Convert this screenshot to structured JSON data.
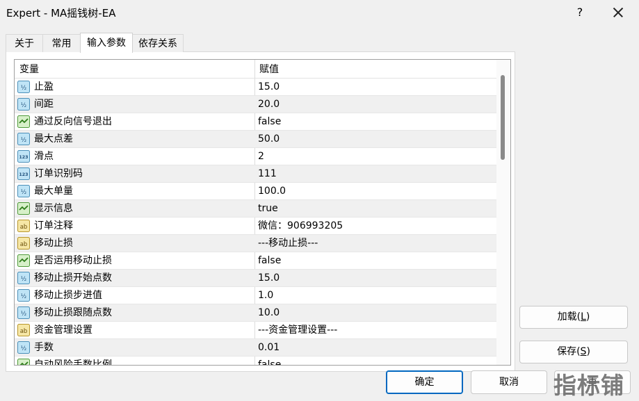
{
  "window": {
    "title": "Expert - MA摇钱树-EA",
    "help_label": "?"
  },
  "tabs": [
    {
      "label": "关于",
      "active": false
    },
    {
      "label": "常用",
      "active": false
    },
    {
      "label": "输入参数",
      "active": true
    },
    {
      "label": "依存关系",
      "active": false
    }
  ],
  "grid": {
    "col_variable": "变量",
    "col_value": "赋值",
    "rows": [
      {
        "icon": "double-value-icon",
        "name": "止盈",
        "value": "15.0"
      },
      {
        "icon": "double-value-icon",
        "name": "间距",
        "value": "20.0"
      },
      {
        "icon": "boolean-value-icon",
        "name": "通过反向信号退出",
        "value": "false"
      },
      {
        "icon": "double-value-icon",
        "name": "最大点差",
        "value": "50.0"
      },
      {
        "icon": "integer-value-icon",
        "name": "滑点",
        "value": "2"
      },
      {
        "icon": "integer-value-icon",
        "name": "订单识别码",
        "value": "111"
      },
      {
        "icon": "double-value-icon",
        "name": "最大单量",
        "value": "100.0"
      },
      {
        "icon": "boolean-value-icon",
        "name": "显示信息",
        "value": "true"
      },
      {
        "icon": "string-value-icon",
        "name": "订单注释",
        "value": "微信：906993205"
      },
      {
        "icon": "string-value-icon",
        "name": "移动止损",
        "value": "---移动止损---"
      },
      {
        "icon": "boolean-value-icon",
        "name": "是否运用移动止损",
        "value": "false"
      },
      {
        "icon": "double-value-icon",
        "name": "移动止损开始点数",
        "value": "15.0"
      },
      {
        "icon": "double-value-icon",
        "name": "移动止损步进值",
        "value": "1.0"
      },
      {
        "icon": "double-value-icon",
        "name": "移动止损跟随点数",
        "value": "10.0"
      },
      {
        "icon": "string-value-icon",
        "name": "资金管理设置",
        "value": "---资金管理设置---"
      },
      {
        "icon": "double-value-icon",
        "name": "手数",
        "value": "0.01"
      },
      {
        "icon": "boolean-value-icon",
        "name": "自动风险手数比例",
        "value": "false"
      }
    ]
  },
  "buttons": {
    "load_text": "加载",
    "load_hotkey": "L",
    "save_text": "保存",
    "save_hotkey": "S",
    "ok_label": "确定",
    "cancel_label": "取消",
    "reset_partial": "重"
  },
  "watermark": "指标铺",
  "colors": {
    "accent": "#0067c0",
    "grid_alt_row": "#f0f0f0",
    "icon_blue": "#9fd3ee",
    "icon_green": "#6ebf4a",
    "icon_yellow": "#e8c64a"
  }
}
